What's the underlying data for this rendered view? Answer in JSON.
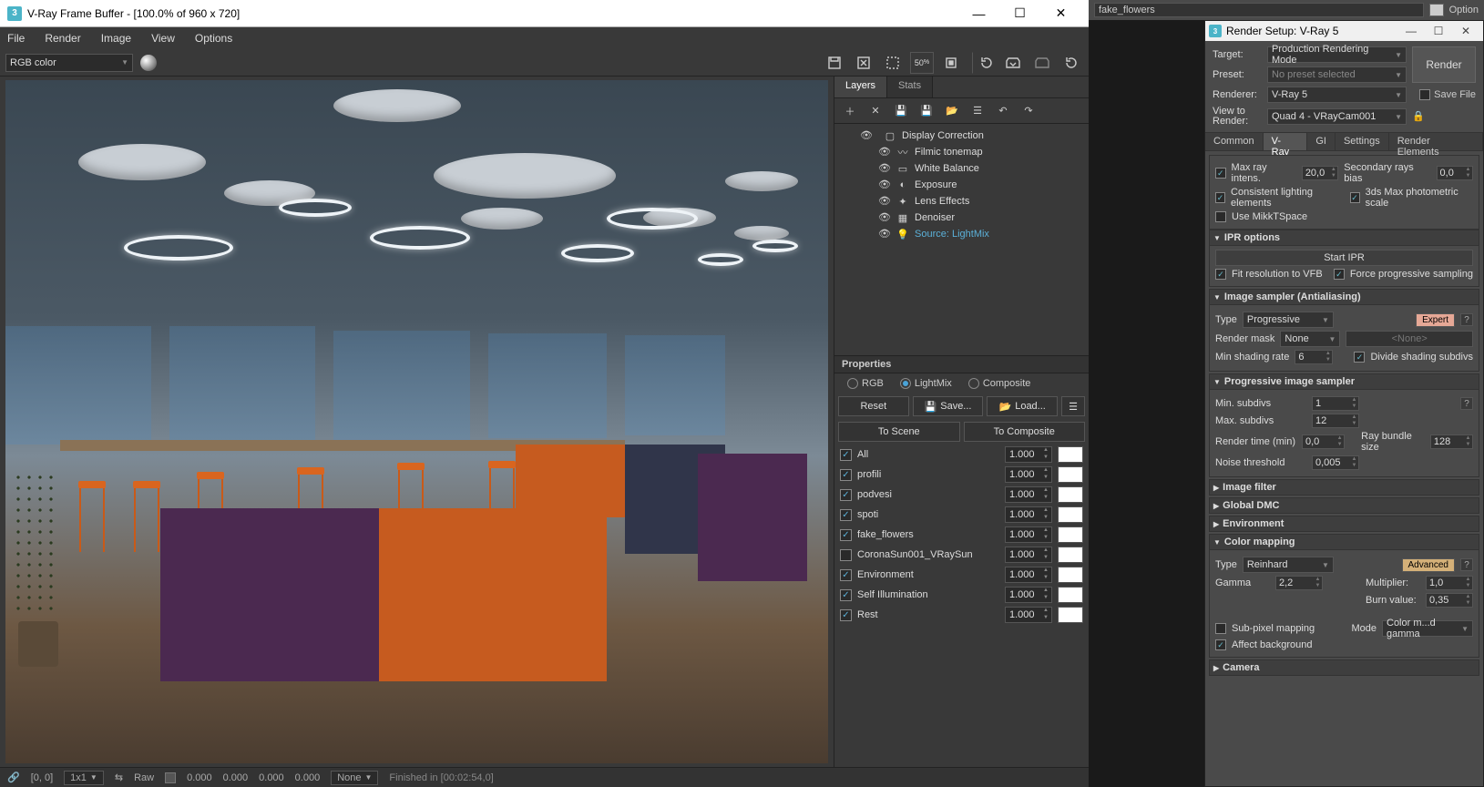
{
  "bg_strip": {
    "field_value": "fake_flowers",
    "option_label": "Option"
  },
  "vfb": {
    "title": "V-Ray Frame Buffer - [100.0% of 960 x 720]",
    "menu": {
      "file": "File",
      "render": "Render",
      "image": "Image",
      "view": "View",
      "options": "Options"
    },
    "channel": "RGB color",
    "zoom_label": "50",
    "side_tabs": {
      "layers": "Layers",
      "stats": "Stats"
    },
    "layers": {
      "root": "Display Correction",
      "items": [
        "Filmic tonemap",
        "White Balance",
        "Exposure",
        "Lens Effects",
        "Denoiser",
        "Source: LightMix"
      ]
    },
    "props": {
      "header": "Properties",
      "radios": {
        "rgb": "RGB",
        "lightmix": "LightMix",
        "composite": "Composite"
      },
      "btns": {
        "reset": "Reset",
        "save": "Save...",
        "load": "Load...",
        "to_scene": "To Scene",
        "to_composite": "To Composite"
      },
      "rows": [
        {
          "name": "All",
          "val": "1.000",
          "on": true
        },
        {
          "name": "profili",
          "val": "1.000",
          "on": true
        },
        {
          "name": "podvesi",
          "val": "1.000",
          "on": true
        },
        {
          "name": "spoti",
          "val": "1.000",
          "on": true
        },
        {
          "name": "fake_flowers",
          "val": "1.000",
          "on": true
        },
        {
          "name": "CoronaSun001_VRaySun",
          "val": "1.000",
          "on": false
        },
        {
          "name": "Environment",
          "val": "1.000",
          "on": true
        },
        {
          "name": "Self Illumination",
          "val": "1.000",
          "on": true
        },
        {
          "name": "Rest",
          "val": "1.000",
          "on": true
        }
      ]
    },
    "status": {
      "coords": "[0, 0]",
      "res": "1x1",
      "raw": "Raw",
      "raw_vals": [
        "0.000",
        "0.000",
        "0.000",
        "0.000"
      ],
      "none": "None",
      "finished": "Finished in [00:02:54,0]"
    }
  },
  "rs": {
    "title": "Render Setup: V-Ray 5",
    "labels": {
      "target": "Target:",
      "preset": "Preset:",
      "renderer": "Renderer:",
      "view": "View to Render:",
      "save_file": "Save File"
    },
    "target_val": "Production Rendering Mode",
    "preset_val": "No preset selected",
    "renderer_val": "V-Ray 5",
    "view_val": "Quad 4 - VRayCam001",
    "render_btn": "Render",
    "tabs": {
      "common": "Common",
      "vray": "V-Ray",
      "gi": "GI",
      "settings": "Settings",
      "re": "Render Elements"
    },
    "top_opts": {
      "max_ray": "Max ray intens.",
      "max_ray_val": "20,0",
      "sec_bias": "Secondary rays bias",
      "sec_bias_val": "0,0",
      "consistent": "Consistent lighting elements",
      "photometric": "3ds Max photometric scale",
      "mikkt": "Use MikkTSpace"
    },
    "ipr": {
      "head": "IPR options",
      "start": "Start IPR",
      "fit": "Fit resolution to VFB",
      "force": "Force progressive sampling"
    },
    "sampler": {
      "head": "Image sampler (Antialiasing)",
      "type": "Type",
      "type_val": "Progressive",
      "expert": "Expert",
      "mask": "Render mask",
      "mask_val": "None",
      "mask_none": "<None>",
      "min_shade": "Min shading rate",
      "min_shade_val": "6",
      "divide": "Divide shading subdivs"
    },
    "prog": {
      "head": "Progressive image sampler",
      "min": "Min. subdivs",
      "min_val": "1",
      "max": "Max. subdivs",
      "max_val": "12",
      "time": "Render time (min)",
      "time_val": "0,0",
      "bundle": "Ray bundle size",
      "bundle_val": "128",
      "noise": "Noise threshold",
      "noise_val": "0,005"
    },
    "collapsed": {
      "filter": "Image filter",
      "dmc": "Global DMC",
      "env": "Environment"
    },
    "cmap": {
      "head": "Color mapping",
      "type": "Type",
      "type_val": "Reinhard",
      "adv": "Advanced",
      "gamma": "Gamma",
      "gamma_val": "2,2",
      "mult": "Multiplier:",
      "mult_val": "1,0",
      "burn": "Burn value:",
      "burn_val": "0,35",
      "subpix": "Sub-pixel mapping",
      "affect": "Affect background",
      "mode": "Mode",
      "mode_val": "Color m...d gamma"
    },
    "camera": {
      "head": "Camera"
    }
  }
}
